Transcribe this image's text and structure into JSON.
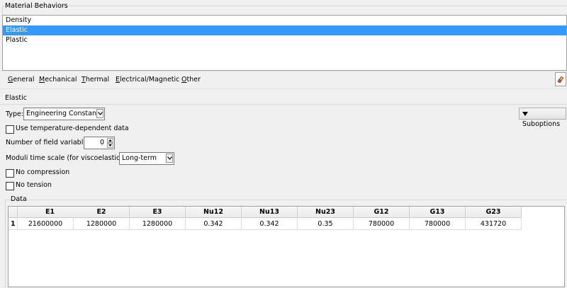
{
  "material_behaviors": {
    "title": "Material Behaviors",
    "items": [
      "Density",
      "Elastic",
      "Plastic"
    ],
    "selected": "Elastic"
  },
  "menu": {
    "items": [
      "General",
      "Mechanical",
      "Thermal",
      "Electrical/Magnetic",
      "Other"
    ]
  },
  "elastic": {
    "title": "Elastic",
    "type_label": "Type:",
    "type_value": "Engineering Constants",
    "suboptions_label": "Suboptions",
    "temp_dependent_label": "Use temperature-dependent data",
    "field_vars_label": "Number of field variables:",
    "field_vars_value": "0",
    "moduli_label": "Moduli time scale (for viscoelasticity):",
    "moduli_value": "Long-term",
    "no_compression_label": "No compression",
    "no_tension_label": "No tension"
  },
  "data": {
    "title": "Data",
    "columns": [
      "E1",
      "E2",
      "E3",
      "Nu12",
      "Nu13",
      "Nu23",
      "G12",
      "G13",
      "G23"
    ],
    "rows": [
      {
        "index": "1",
        "values": [
          "21600000",
          "1280000",
          "1280000",
          "0.342",
          "0.342",
          "0.35",
          "780000",
          "780000",
          "431720"
        ]
      }
    ]
  },
  "colors": {
    "selection": "#3399ff",
    "background": "#f0f0f0"
  }
}
